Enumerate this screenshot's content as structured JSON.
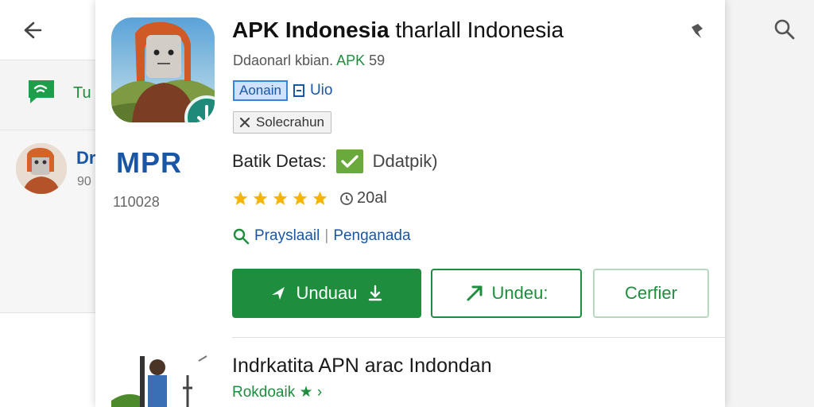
{
  "background": {
    "left_row_label": "Tu",
    "left_item_title": "Dr",
    "left_item_sub": "90"
  },
  "app": {
    "title": "APK Indonesia",
    "title_rest": "tharlall Indonesia",
    "developer_line": "Ddaonarl kbian.",
    "developer_tag": "APK",
    "developer_extra": "59",
    "tag_primary": "Aonain",
    "tag_secondary": "Uio",
    "chip_label": "Solecrahun",
    "logo_text": "MPR",
    "left_number": "110028",
    "detail_label": "Batik Detas:",
    "detail_value": "Ddatpik)",
    "rating_count": "5",
    "rating_extra": "20al",
    "link_primary": "Prayslaail",
    "link_secondary": "Penganada"
  },
  "buttons": {
    "primary": "Unduau",
    "outline": "Undeu:",
    "ghost": "Cerfier"
  },
  "related": {
    "title": "Indrkatita APN arac Indondan",
    "subtitle": "Rokdoaik"
  },
  "colors": {
    "accent_green": "#1e8e3e",
    "link_blue": "#1a56a6",
    "star_yellow": "#f4b400"
  }
}
